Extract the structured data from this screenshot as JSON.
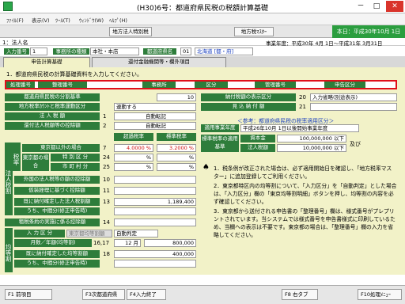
{
  "window": {
    "title": "(H30)6号：都道府県民税の税額計算基礎",
    "minimize": "－",
    "maximize": "□",
    "close": "✕"
  },
  "menu": [
    "ﾌｧｲﾙ(F)",
    "表示(V)",
    "ﾂｰﾙ(T)",
    "ｳｨﾝﾄﾞｳ(W)",
    "ﾍﾙﾌﾟ(H)"
  ],
  "toolbar": {
    "btn1": "地方法人特別税",
    "btn2": "地方税ﾏｽﾀｰ",
    "today": "本日：平成30年10月 1日(月)"
  },
  "corp": {
    "label": "1：法人名",
    "period": "事業年度：平成30年 4月 1日～平成31年 3月31日"
  },
  "header": {
    "input_no_label": "入力番号",
    "input_no": "1",
    "office_type_label": "事務所の種類",
    "office_type": "本社・本店",
    "pref_label": "都道府県名",
    "pref_code": "01",
    "pref_name": "北海道 [都・府]"
  },
  "tabs": {
    "tab1": "申告計算基礎",
    "tab2": "還付金融機関等・欄外項目"
  },
  "instruction": "1．都道府県民税の計算基礎資料を入力してください。",
  "redrow": [
    "処理番号",
    "整理番号",
    "事務所",
    "区分",
    "管理番号",
    "申告区分"
  ],
  "left": {
    "r1_label": "都道府県民税の分割基準",
    "r1_val": "10",
    "r2_label": "地方税率ｶｳﾝﾄと税率運動区分",
    "r2_val": "連動する",
    "r3_label": "法 人 税 額",
    "r3_no": "1",
    "r3_val": "自動転記",
    "r4_label": "還付法人税額等の控除額",
    "r4_no": "2",
    "r4_val": "自動転記",
    "rate_h1": "超過税率",
    "rate_h2": "標準税率",
    "r5_label": "東京都以外の場合",
    "r5_no": "7",
    "r5_v1": "4.0000 %",
    "r5_v2": "3.2000 %",
    "r6_label": "特 別 区 分",
    "r6_no": "24",
    "r6_v1": "%",
    "r6_v2": "%",
    "r6b_label": "東京都の場合",
    "r7_label": "市 町 村 分",
    "r7_no": "25",
    "r7_v1": "%",
    "r7_v2": "%",
    "r8_label": "外国の法人税等の額の控除額",
    "r8_no": "10",
    "r9_label": "仮装経理に基づく控除額",
    "r9_no": "11",
    "r10_label": "既に納付確定した法人税割額",
    "r10_no": "13",
    "r10_val": "1,189,400",
    "r11_label": "うち、中間分(修正申告時)",
    "r12_label": "租税条約の実施に係る控除額",
    "r12_no": "14",
    "r13_label": "入 力 区 分",
    "r13_val": "自動判定",
    "r13_sel": "東京都均等割額",
    "r14_label": "月数／年額(均等割)",
    "r14_no": "16,17",
    "r14_months": "12 月",
    "r14_amount": "800,000",
    "r15_label": "既に納付確定した均等割額",
    "r15_no": "18",
    "r15_val": "400,000",
    "r16_label": "うち、中間分(修正申告時)",
    "side1": "法人税割",
    "side2": "均等割",
    "side3": "税率"
  },
  "right": {
    "r1_label": "納付税額の表示区分",
    "r1_no": "20",
    "r1_val": "入力省略(別途表示)",
    "r2_label": "見 込 納 付 額",
    "r2_no": "21",
    "ref_title": "＜参考：都道府県民税の税率適用区分＞",
    "ref_sub": "平成26年10月 1日以後開始事業年度",
    "apply_label": "適用事業年度",
    "std_label": "標準税率の適用基準",
    "capital_label": "資本金",
    "capital_val": "100,000,000 以下",
    "corp_tax_label": "法人税額",
    "corp_tax_val": "10,000,000 以下",
    "and": "及び"
  },
  "notes": [
    "1．税条例が改正された場合は、必ず適用開始日を確認し、「地方税率マスター」に追加登録してご利用ください。",
    "2．東京都特区内の均等割について、「入力区分」を「自動判定」とした場合は、「入力区分」欄の「東京均等割明細」ボタンを押し、均等割の内容を必ず確認してください。",
    "3．東京都から送付される申告書の「整理番号」欄は、様式番号がプレプリントされています。当システムでは様式番号を申告書様式に印刷しているため、当欄への表示は不要です。東京都の場合は、「整理番号」欄の入力を省略してください。"
  ],
  "fkeys": [
    "F1 前項目",
    "F3次都道府県",
    "F4入力終了",
    "F8 右タブ",
    "F10処理ﾒﾆｭｰ"
  ]
}
